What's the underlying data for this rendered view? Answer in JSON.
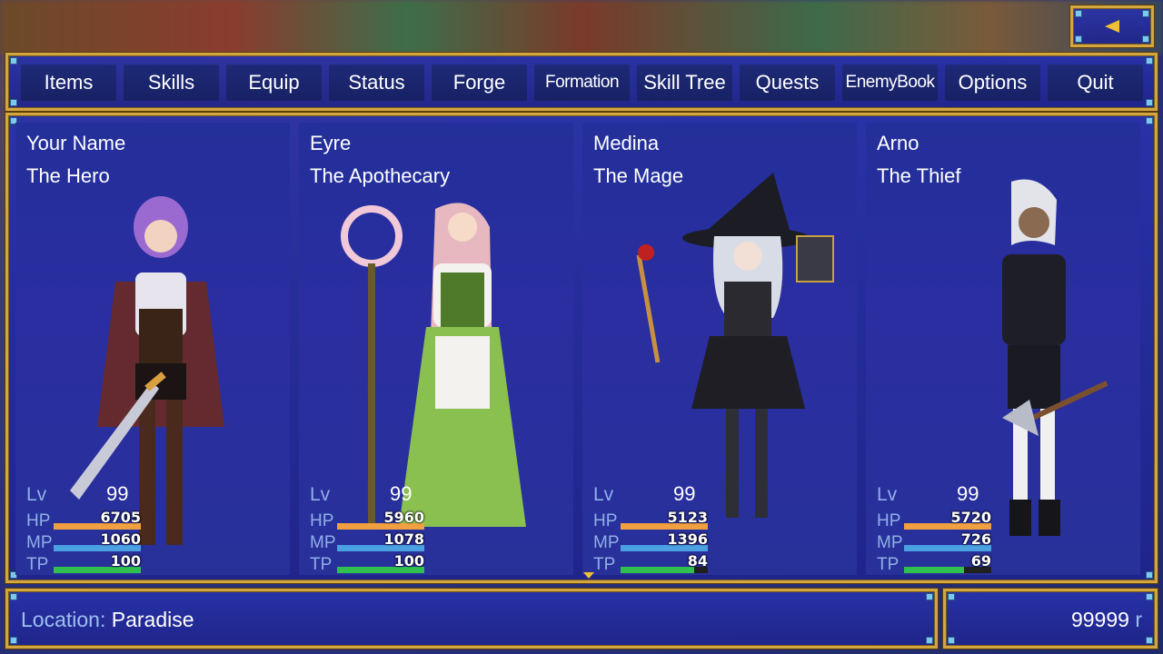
{
  "back_button": {
    "icon": "chevron-left-icon"
  },
  "menu": {
    "items": [
      {
        "label": "Items"
      },
      {
        "label": "Skills"
      },
      {
        "label": "Equip"
      },
      {
        "label": "Status"
      },
      {
        "label": "Forge"
      },
      {
        "label": "Formation"
      },
      {
        "label": "Skill Tree"
      },
      {
        "label": "Quests"
      },
      {
        "label": "EnemyBook"
      },
      {
        "label": "Options"
      },
      {
        "label": "Quit"
      }
    ]
  },
  "party": {
    "members": [
      {
        "name": "Your Name",
        "class": "The Hero",
        "lv_label": "Lv",
        "lv": "99",
        "hp_label": "HP",
        "hp": "6705",
        "mp_label": "MP",
        "mp": "1060",
        "tp_label": "TP",
        "tp": "100",
        "hp_fill": 1.0,
        "mp_fill": 1.0,
        "tp_fill": 1.0
      },
      {
        "name": "Eyre",
        "class": "The Apothecary",
        "lv_label": "Lv",
        "lv": "99",
        "hp_label": "HP",
        "hp": "5960",
        "mp_label": "MP",
        "mp": "1078",
        "tp_label": "TP",
        "tp": "100",
        "hp_fill": 1.0,
        "mp_fill": 1.0,
        "tp_fill": 1.0
      },
      {
        "name": "Medina",
        "class": "The Mage",
        "lv_label": "Lv",
        "lv": "99",
        "hp_label": "HP",
        "hp": "5123",
        "mp_label": "MP",
        "mp": "1396",
        "tp_label": "TP",
        "tp": "84",
        "hp_fill": 1.0,
        "mp_fill": 1.0,
        "tp_fill": 0.84
      },
      {
        "name": "Arno",
        "class": "The Thief",
        "lv_label": "Lv",
        "lv": "99",
        "hp_label": "HP",
        "hp": "5720",
        "mp_label": "MP",
        "mp": "726",
        "tp_label": "TP",
        "tp": "69",
        "hp_fill": 1.0,
        "mp_fill": 1.0,
        "tp_fill": 0.69
      }
    ]
  },
  "footer": {
    "location_label": "Location:",
    "location_value": "Paradise",
    "gold_value": "99999",
    "gold_unit": "r"
  },
  "colors": {
    "hp": "#f0a040",
    "mp": "#4aa0e0",
    "tp": "#30c050",
    "border": "#d2a640"
  }
}
